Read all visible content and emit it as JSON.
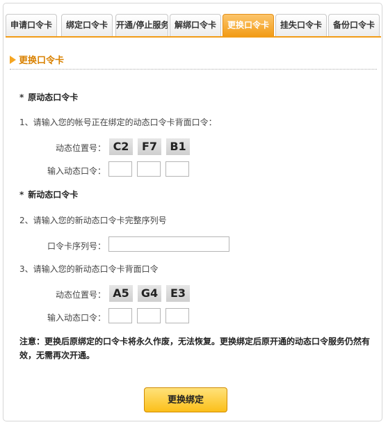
{
  "tabs": [
    {
      "label": "申请口令卡"
    },
    {
      "label": "绑定口令卡"
    },
    {
      "label": "开通/停止服务"
    },
    {
      "label": "解绑口令卡"
    },
    {
      "label": "更换口令卡",
      "active": true
    },
    {
      "label": "挂失口令卡"
    },
    {
      "label": "备份口令卡"
    }
  ],
  "section_title": "更换口令卡",
  "old_card": {
    "heading": "原动态口令卡",
    "step": "1、请输入您的帐号正在绑定的动态口令卡背面口令：",
    "position_label": "动态位置号：",
    "positions": [
      "C2",
      "F7",
      "B1"
    ],
    "input_label": "输入动态口令："
  },
  "new_card": {
    "heading": "新动态口令卡",
    "step_serial": "2、请输入您的新动态口令卡完整序列号",
    "serial_label": "口令卡序列号：",
    "serial_value": "",
    "step_code": "3、请输入您的新动态口令卡背面口令",
    "position_label": "动态位置号：",
    "positions": [
      "A5",
      "G4",
      "E3"
    ],
    "input_label": "输入动态口令："
  },
  "note": "注意：更换后原绑定的口令卡将永久作废，无法恢复。更换绑定后原开通的动态口令服务仍然有效，无需再次开通。",
  "confirm_button": "更换绑定",
  "colors": {
    "accent": "#f29c17",
    "title": "#d98100"
  }
}
